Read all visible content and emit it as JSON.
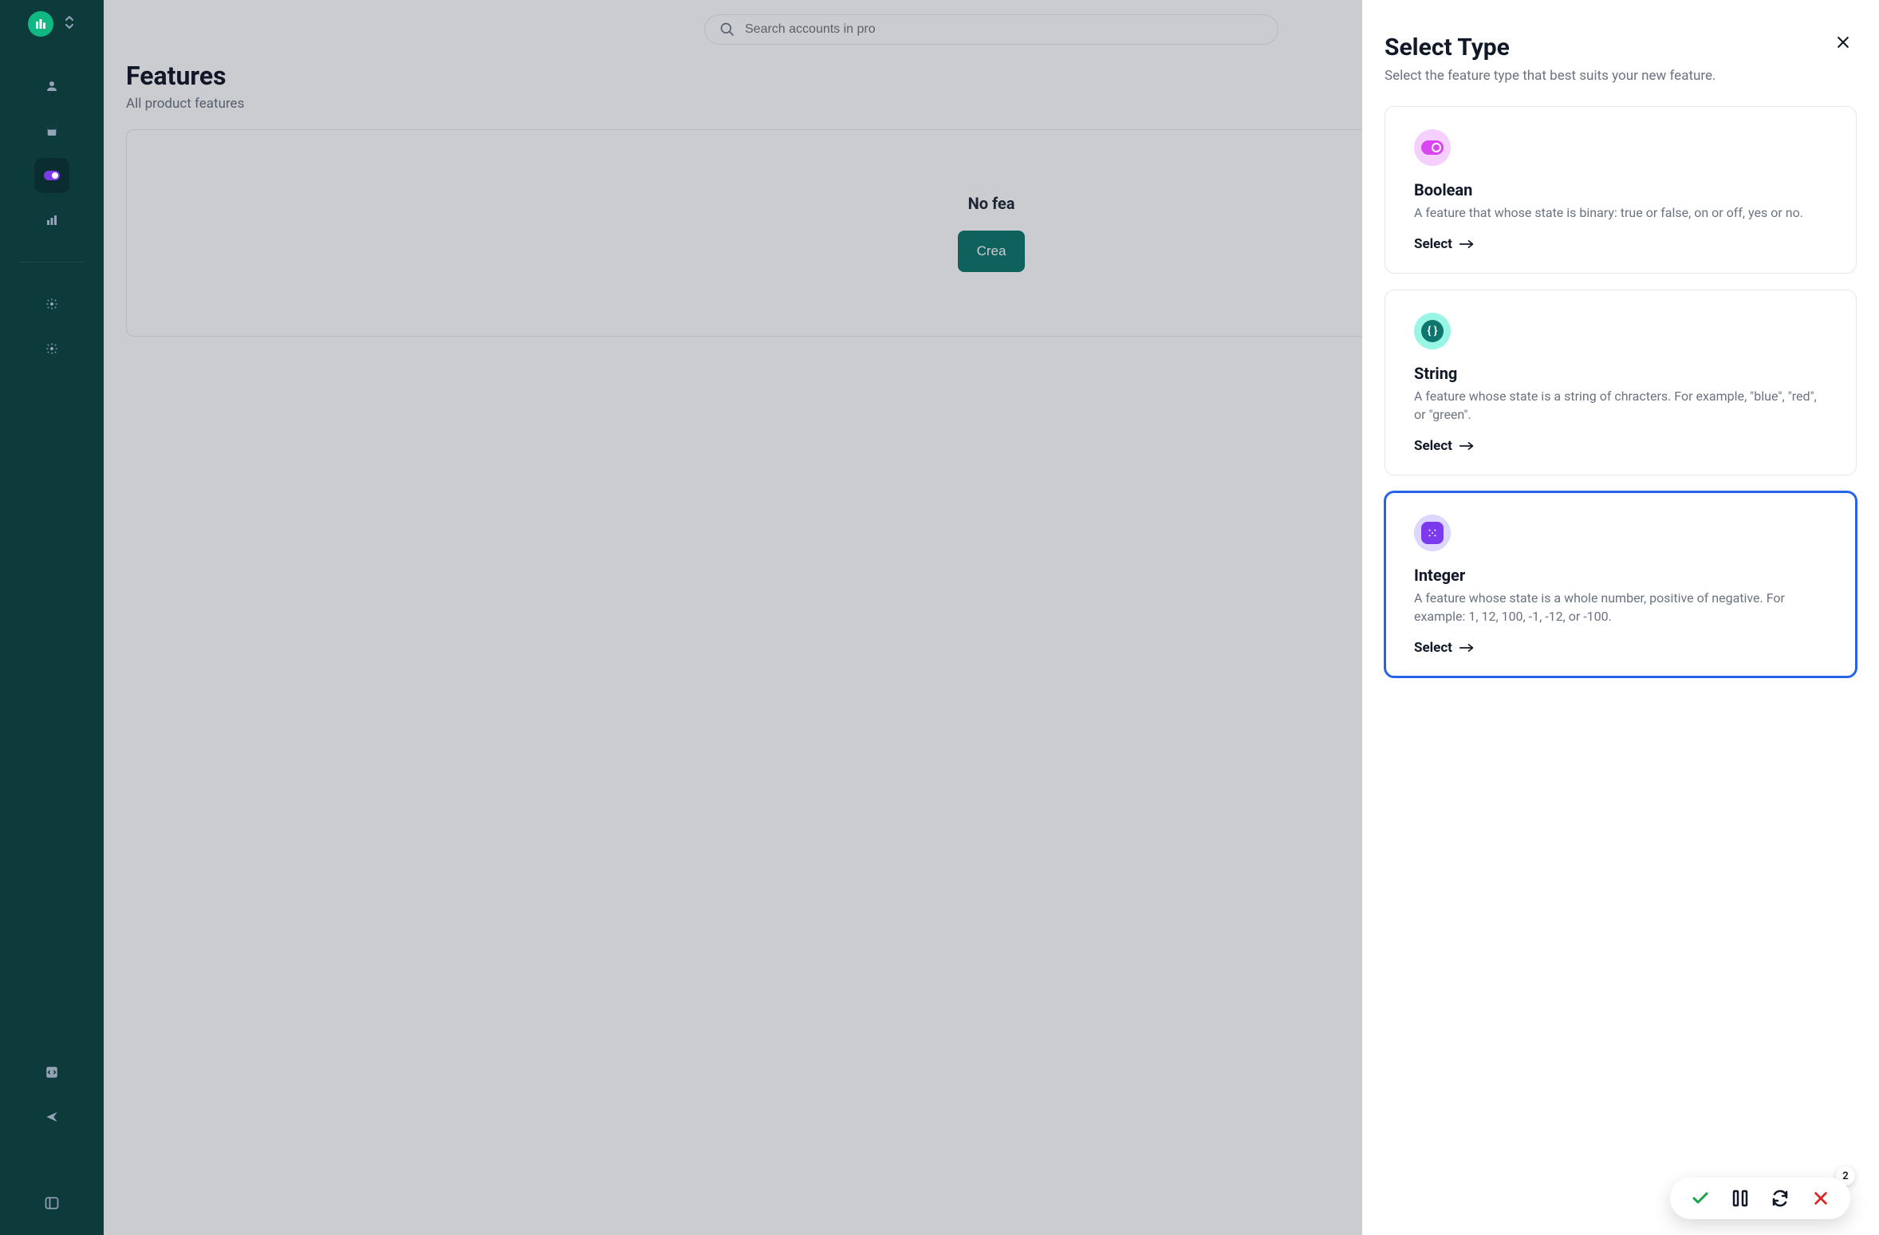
{
  "search": {
    "placeholder": "Search accounts in pro"
  },
  "page": {
    "title": "Features",
    "subtitle": "All product features",
    "empty_title": "No fea",
    "create_label": "Crea"
  },
  "drawer": {
    "title": "Select Type",
    "subtitle": "Select the feature type that best suits your new feature.",
    "types": [
      {
        "title": "Boolean",
        "desc": "A feature that whose state is binary: true or false, on or off, yes or no.",
        "select": "Select"
      },
      {
        "title": "String",
        "desc": "A feature whose state is a string of chracters. For example, \"blue\", \"red\", or \"green\".",
        "select": "Select"
      },
      {
        "title": "Integer",
        "desc": "A feature whose state is a whole number, positive of negative. For example: 1, 12, 100, -1, -12, or -100.",
        "select": "Select"
      }
    ]
  },
  "float": {
    "badge": "2"
  }
}
